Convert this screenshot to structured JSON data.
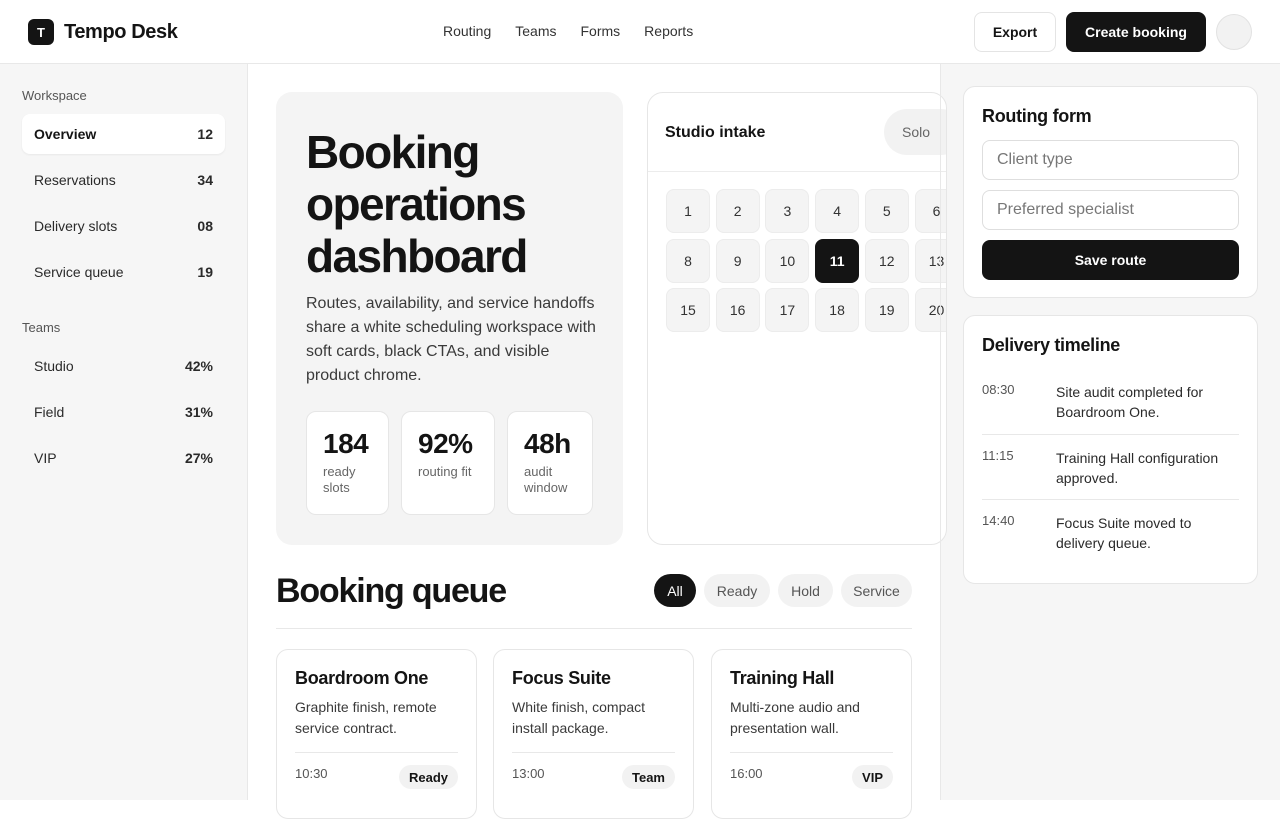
{
  "header": {
    "brand_mark": "T",
    "brand_name": "Tempo Desk",
    "nav": [
      "Routing",
      "Teams",
      "Forms",
      "Reports"
    ],
    "export_label": "Export",
    "create_label": "Create booking"
  },
  "sidebar": {
    "workspace_heading": "Workspace",
    "workspace_items": [
      {
        "label": "Overview",
        "count": "12"
      },
      {
        "label": "Reservations",
        "count": "34"
      },
      {
        "label": "Delivery slots",
        "count": "08"
      },
      {
        "label": "Service queue",
        "count": "19"
      }
    ],
    "teams_heading": "Teams",
    "team_items": [
      {
        "label": "Studio",
        "count": "42%"
      },
      {
        "label": "Field",
        "count": "31%"
      },
      {
        "label": "VIP",
        "count": "27%"
      }
    ]
  },
  "hero": {
    "title": "Booking operations dashboard",
    "description": "Routes, availability, and service handoffs share a white scheduling workspace with soft cards, black CTAs, and visible product chrome.",
    "stats": [
      {
        "value": "184",
        "label": "ready slots"
      },
      {
        "value": "92%",
        "label": "routing fit"
      },
      {
        "value": "48h",
        "label": "audit window"
      }
    ]
  },
  "calendar": {
    "title": "Studio intake",
    "pill": "Solo",
    "days": [
      "1",
      "2",
      "3",
      "4",
      "5",
      "6",
      "8",
      "9",
      "10",
      "11",
      "12",
      "13",
      "15",
      "16",
      "17",
      "18",
      "19",
      "20"
    ],
    "selected_day": "11"
  },
  "queue": {
    "title": "Booking queue",
    "filters": [
      "All",
      "Ready",
      "Hold",
      "Service"
    ],
    "active_filter": "All",
    "cards": [
      {
        "title": "Boardroom One",
        "desc": "Graphite finish, remote service contract.",
        "time": "10:30",
        "badge": "Ready"
      },
      {
        "title": "Focus Suite",
        "desc": "White finish, compact install package.",
        "time": "13:00",
        "badge": "Team"
      },
      {
        "title": "Training Hall",
        "desc": "Multi-zone audio and presentation wall.",
        "time": "16:00",
        "badge": "VIP"
      }
    ]
  },
  "routing_form": {
    "title": "Routing form",
    "client_type_placeholder": "Client type",
    "specialist_placeholder": "Preferred specialist",
    "save_label": "Save route"
  },
  "timeline": {
    "title": "Delivery timeline",
    "events": [
      {
        "time": "08:30",
        "text": "Site audit completed for Boardroom One."
      },
      {
        "time": "11:15",
        "text": "Training Hall configuration approved."
      },
      {
        "time": "14:40",
        "text": "Focus Suite moved to delivery queue."
      }
    ]
  }
}
